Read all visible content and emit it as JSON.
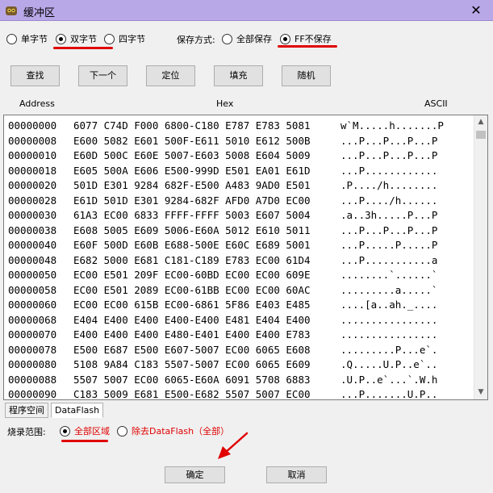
{
  "window": {
    "title": "缓冲区",
    "close_glyph": "✕"
  },
  "byte_mode": {
    "options": [
      {
        "label": "单字节",
        "checked": false
      },
      {
        "label": "双字节",
        "checked": true
      },
      {
        "label": "四字节",
        "checked": false
      }
    ]
  },
  "save_mode": {
    "label": "保存方式:",
    "options": [
      {
        "label": "全部保存",
        "checked": false
      },
      {
        "label": "FF不保存",
        "checked": true
      }
    ]
  },
  "toolbar": {
    "find": "查找",
    "next": "下一个",
    "locate": "定位",
    "fill": "填充",
    "random": "随机"
  },
  "columns": {
    "address": "Address",
    "hex": "Hex",
    "ascii": "ASCII"
  },
  "rows": [
    {
      "addr": "00000000",
      "hex": "6077 C74D F000 6800-C180 E787 E783 5081",
      "ascii": "w`M.....h.......P"
    },
    {
      "addr": "00000008",
      "hex": "E600 5082 E601 500F-E611 5010 E612 500B",
      "ascii": "...P...P...P...P"
    },
    {
      "addr": "00000010",
      "hex": "E60D 500C E60E 5007-E603 5008 E604 5009",
      "ascii": "...P...P...P...P"
    },
    {
      "addr": "00000018",
      "hex": "E605 500A E606 E500-999D E501 EA01 E61D",
      "ascii": "...P............"
    },
    {
      "addr": "00000020",
      "hex": "501D E301 9284 682F-E500 A483 9AD0 E501",
      "ascii": ".P..../h........"
    },
    {
      "addr": "00000028",
      "hex": "E61D 501D E301 9284-682F AFD0 A7D0 EC00",
      "ascii": "...P..../h......"
    },
    {
      "addr": "00000030",
      "hex": "61A3 EC00 6833 FFFF-FFFF 5003 E607 5004",
      "ascii": ".a..3h.....P...P"
    },
    {
      "addr": "00000038",
      "hex": "E608 5005 E609 5006-E60A 5012 E610 5011",
      "ascii": "...P...P...P...P"
    },
    {
      "addr": "00000040",
      "hex": "E60F 500D E60B E688-500E E60C E689 5001",
      "ascii": "...P.....P.....P"
    },
    {
      "addr": "00000048",
      "hex": "E682 5000 E681 C181-C189 E783 EC00 61D4",
      "ascii": "...P...........a"
    },
    {
      "addr": "00000050",
      "hex": "EC00 E501 209F EC00-60BD EC00 EC00 609E",
      "ascii": "........`......`"
    },
    {
      "addr": "00000058",
      "hex": "EC00 E501 2089 EC00-61BB EC00 EC00 60AC",
      "ascii": ".........a.....`"
    },
    {
      "addr": "00000060",
      "hex": "EC00 EC00 615B EC00-6861 5F86 E403 E485",
      "ascii": "....[a..ah._...."
    },
    {
      "addr": "00000068",
      "hex": "E404 E400 E400 E400-E400 E481 E404 E400",
      "ascii": "................"
    },
    {
      "addr": "00000070",
      "hex": "E400 E400 E400 E480-E401 E400 E400 E783",
      "ascii": "................"
    },
    {
      "addr": "00000078",
      "hex": "E500 E687 E500 E607-5007 EC00 6065 E608",
      "ascii": ".........P...e`."
    },
    {
      "addr": "00000080",
      "hex": "5108 9A84 C183 5507-5007 EC00 6065 E609",
      "ascii": ".Q.....U.P..e`.."
    },
    {
      "addr": "00000088",
      "hex": "5507 5007 EC00 6065-E60A 6091 5708 6883",
      "ascii": ".U.P..e`...`.W.h"
    },
    {
      "addr": "00000090",
      "hex": "C183 5009 E681 E500-E682 5507 5007 EC00",
      "ascii": "...P.......U.P.."
    }
  ],
  "tabs": [
    {
      "label": "程序空间",
      "active": false
    },
    {
      "label": "DataFlash",
      "active": true
    }
  ],
  "burn_range": {
    "label": "烧录范围:",
    "options": [
      {
        "label": "全部区域",
        "checked": true
      },
      {
        "label": "除去DataFlash（全部）",
        "checked": false
      }
    ]
  },
  "footer": {
    "ok": "确定",
    "cancel": "取消"
  },
  "colors": {
    "annotation": "#e00000",
    "titlebar": "#b9a8e8"
  }
}
